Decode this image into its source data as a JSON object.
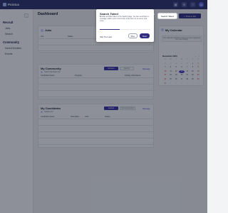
{
  "app": {
    "name": "Pointus"
  },
  "colors": {
    "brand": "#2b2f6c",
    "accent": "#312e81",
    "weekend": "#dc2626"
  },
  "topbar": {
    "icons": [
      "grid-icon",
      "chat-icon",
      "help-icon"
    ],
    "avatar_initials": "JD"
  },
  "sidebar": {
    "collapse_icon": "‹",
    "sections": [
      {
        "title": "Recruit",
        "items": [
          "Jobs",
          "Search"
        ]
      },
      {
        "title": "Community",
        "items": [
          "Saved Workers",
          "Events"
        ]
      }
    ]
  },
  "page": {
    "title": "Dashboard",
    "search_talent_label": "Search Talent",
    "post_job_label": "Post a Job",
    "post_job_icon": "+"
  },
  "jobs": {
    "title": "Jobs",
    "columns": [
      "Job",
      "Status"
    ]
  },
  "community": {
    "title": "My Community",
    "subtitle": "Talent Members (0)",
    "tab_active": "Workers",
    "tab_inactive": "Events",
    "manage_label": "Manage",
    "columns": [
      "Candidate Name",
      "Program",
      "Activity, Attendance"
    ]
  },
  "candidates": {
    "title": "My Candidates",
    "subtitle": "Applied (0)",
    "tab_active": "Applied",
    "tab_inactive": "Recommended",
    "manage_label": "Manage",
    "columns": [
      "Candidate Name",
      "Submitted",
      "Jobs",
      "Status"
    ]
  },
  "calendar": {
    "title": "My Calendar",
    "notice": "Your calendar will show events you have registered for or are hosting",
    "month": "December 2023",
    "prev_icon": "‹",
    "next_icon": "›",
    "weekdays": [
      "S",
      "M",
      "T",
      "W",
      "T",
      "F",
      "S"
    ],
    "days": [
      [
        "26",
        "27",
        "28",
        "29",
        "30",
        "1",
        "2"
      ],
      [
        "3",
        "4",
        "5",
        "6",
        "7",
        "8",
        "9"
      ],
      [
        "10",
        "11",
        "12",
        "13",
        "14",
        "15",
        "16"
      ],
      [
        "17",
        "18",
        "19",
        "20",
        "21",
        "22",
        "23"
      ],
      [
        "24",
        "25",
        "26",
        "27",
        "28",
        "29",
        "30"
      ],
      [
        "31",
        "1",
        "2",
        "3",
        "4",
        "5",
        "6"
      ]
    ],
    "today": "13"
  },
  "tour": {
    "title": "Search Talent",
    "body": "Browse and filter talent in the Search page. You can send them a message, add to your Community, invite them to an event, and more.",
    "progress": 0.4,
    "skip_label": "Skip Tour Later",
    "prev_label": "Prev",
    "next_label": "Next"
  }
}
